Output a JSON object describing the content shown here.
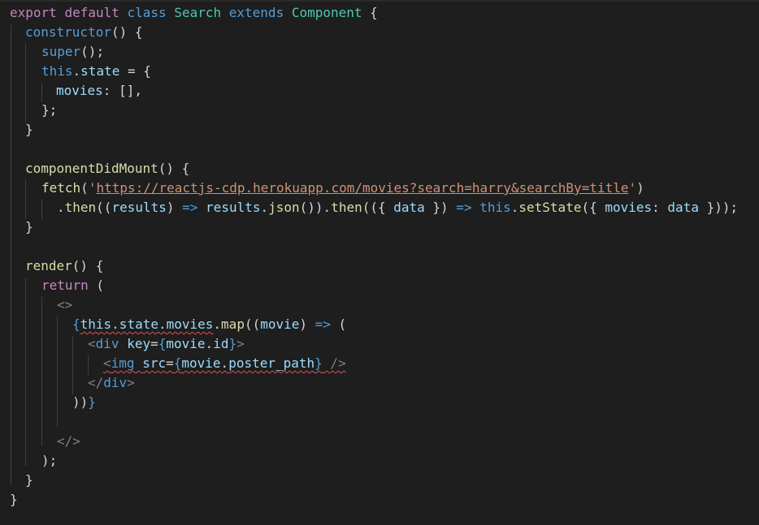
{
  "code": {
    "l1": {
      "t1": "export",
      "t2": " ",
      "t3": "default",
      "t4": " ",
      "t5": "class",
      "t6": " ",
      "t7": "Search",
      "t8": " ",
      "t9": "extends",
      "t10": " ",
      "t11": "Component",
      "t12": " {"
    },
    "l2": {
      "t1": "constructor",
      "t2": "() {"
    },
    "l3": {
      "t1": "super",
      "t2": "();"
    },
    "l4": {
      "t1": "this",
      "t2": ".",
      "t3": "state",
      "t4": " = {"
    },
    "l5": {
      "t1": "movies",
      "t2": ": [],"
    },
    "l6": {
      "t1": "};"
    },
    "l7": {
      "t1": "}"
    },
    "l9": {
      "t1": "componentDidMount",
      "t2": "() {"
    },
    "l10": {
      "t1": "fetch",
      "t2": "(",
      "t3": "'",
      "t4": "https://reactjs-cdp.herokuapp.com/movies?search=harry&searchBy=title",
      "t5": "'",
      "t6": ")"
    },
    "l11": {
      "t1": ".",
      "t2": "then",
      "t3": "((",
      "t4": "results",
      "t5": ") ",
      "t6": "=>",
      "t7": " ",
      "t8": "results",
      "t9": ".",
      "t10": "json",
      "t11": "()).",
      "t12": "then",
      "t13": "(({ ",
      "t14": "data",
      "t15": " }) ",
      "t16": "=>",
      "t17": " ",
      "t18": "this",
      "t19": ".",
      "t20": "setState",
      "t21": "({ ",
      "t22": "movies",
      "t23": ": ",
      "t24": "data",
      "t25": " }));"
    },
    "l12": {
      "t1": "}"
    },
    "l14": {
      "t1": "render",
      "t2": "() {"
    },
    "l15": {
      "t1": "return",
      "t2": " ("
    },
    "l16": {
      "t1": "<>"
    },
    "l17": {
      "t1": "{",
      "t2": "this.state.movies",
      "t3": ".",
      "t4": "map",
      "t5": "((",
      "t6": "movie",
      "t7": ") ",
      "t8": "=>",
      "t9": " ("
    },
    "l18": {
      "t1": "<",
      "t2": "div",
      "t3": " ",
      "t4": "key",
      "t5": "=",
      "t6": "{",
      "t7": "movie",
      "t8": ".",
      "t9": "id",
      "t10": "}",
      "t11": ">"
    },
    "l19": {
      "t1": "<",
      "t2": "img",
      "t3": " ",
      "t4": "src",
      "t5": "=",
      "t6": "{",
      "t7": "movie",
      "t8": ".",
      "t9": "poster_path",
      "t10": "}",
      "t11": " />"
    },
    "l20": {
      "t1": "</",
      "t2": "div",
      "t3": ">"
    },
    "l21": {
      "t1": "))",
      "t2": "}"
    },
    "l23": {
      "t1": "</>"
    },
    "l24": {
      "t1": ");"
    },
    "l25": {
      "t1": "}"
    },
    "l26": {
      "t1": "}"
    }
  },
  "colors": {
    "background": "#1e1e1e",
    "keyword": "#c586c0",
    "storage": "#569cd6",
    "type": "#4ec9b0",
    "function": "#dcdcaa",
    "variable": "#9cdcfe",
    "string": "#ce9178",
    "punctuation": "#d4d4d4",
    "error_squiggle": "#e05252"
  }
}
